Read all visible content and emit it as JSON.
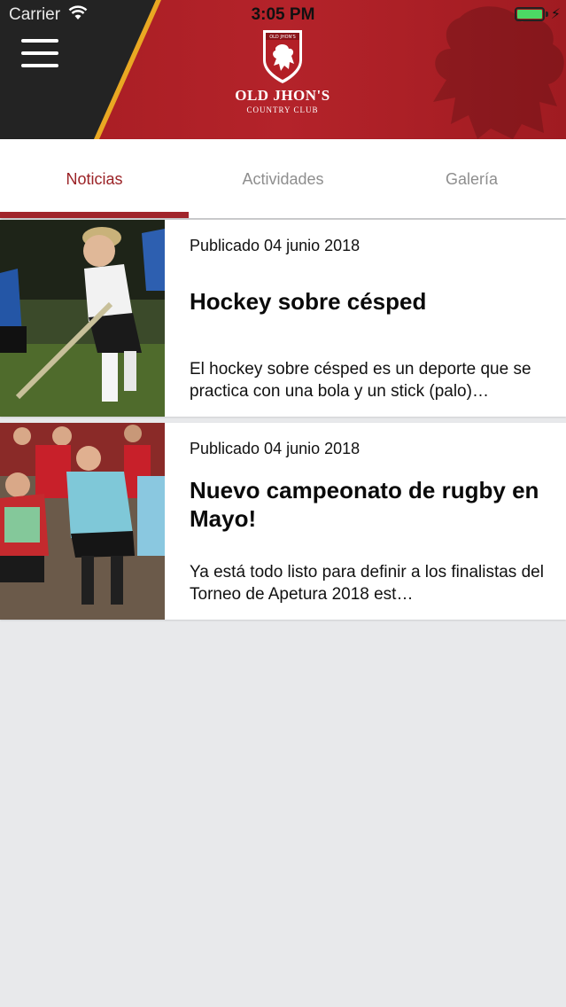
{
  "status_bar": {
    "carrier": "Carrier",
    "time": "3:05 PM"
  },
  "header": {
    "club_name": "OLD JHON'S",
    "club_subtitle": "COUNTRY CLUB",
    "crest_text": "OLD JHON'S",
    "brand_color": "#a51c22"
  },
  "tabs": [
    {
      "label": "Noticias",
      "active": true
    },
    {
      "label": "Actividades",
      "active": false
    },
    {
      "label": "Galería",
      "active": false
    }
  ],
  "news": [
    {
      "date": "Publicado 04 junio 2018",
      "title": "Hockey sobre césped",
      "excerpt": "El hockey sobre césped es un deporte que se practica con una bola y un stick (palo)…"
    },
    {
      "date": "Publicado 04 junio 2018",
      "title": "Nuevo campeonato de rugby en Mayo!",
      "excerpt": "Ya está todo listo para definir a los finalistas del Torneo de Apetura 2018 est…"
    }
  ]
}
